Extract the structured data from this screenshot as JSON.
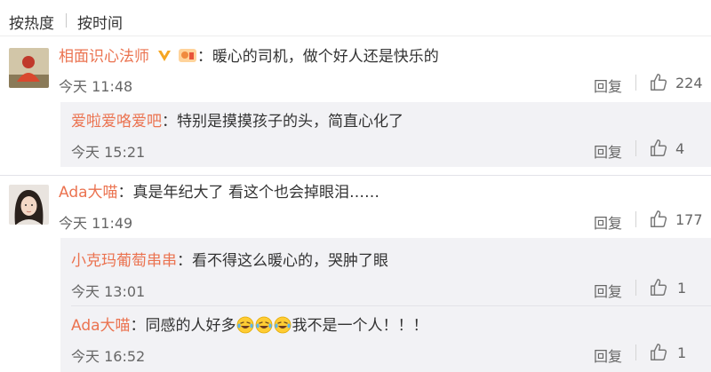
{
  "sort_tabs": {
    "hot": "按热度",
    "time": "按时间"
  },
  "actions": {
    "reply": "回复"
  },
  "icons": {
    "like": "thumbs-up-icon",
    "verified": "verified-v-icon",
    "member": "member-badge-icon",
    "emoji": "laughing-tears-emoji"
  },
  "colors": {
    "username": "#eb7350",
    "text": "#333333",
    "meta": "#666666",
    "sub_panel": "#f2f2f5"
  },
  "comments": [
    {
      "user": "相面识心法师",
      "sep": "：",
      "text": "暖心的司机，做个好人还是快乐的",
      "time": "今天 11:48",
      "likes": "224",
      "replies": [
        {
          "user": "爱啦爱咯爱吧",
          "sep": "：",
          "text": "特别是摸摸孩子的头，简直心化了",
          "time": "今天 15:21",
          "likes": "4"
        }
      ]
    },
    {
      "user": "Ada大喵",
      "sep": "：",
      "text": "真是年纪大了 看这个也会掉眼泪……",
      "time": "今天 11:49",
      "likes": "177",
      "replies": [
        {
          "user": "小克玛葡萄串串",
          "sep": "：",
          "text": "看不得这么暖心的，哭肿了眼",
          "time": "今天 13:01",
          "likes": "1"
        },
        {
          "user": "Ada大喵",
          "sep": "：",
          "text_before": "同感的人好多",
          "text_after": "我不是一个人！！！",
          "time": "今天 16:52",
          "likes": "1"
        }
      ]
    }
  ]
}
